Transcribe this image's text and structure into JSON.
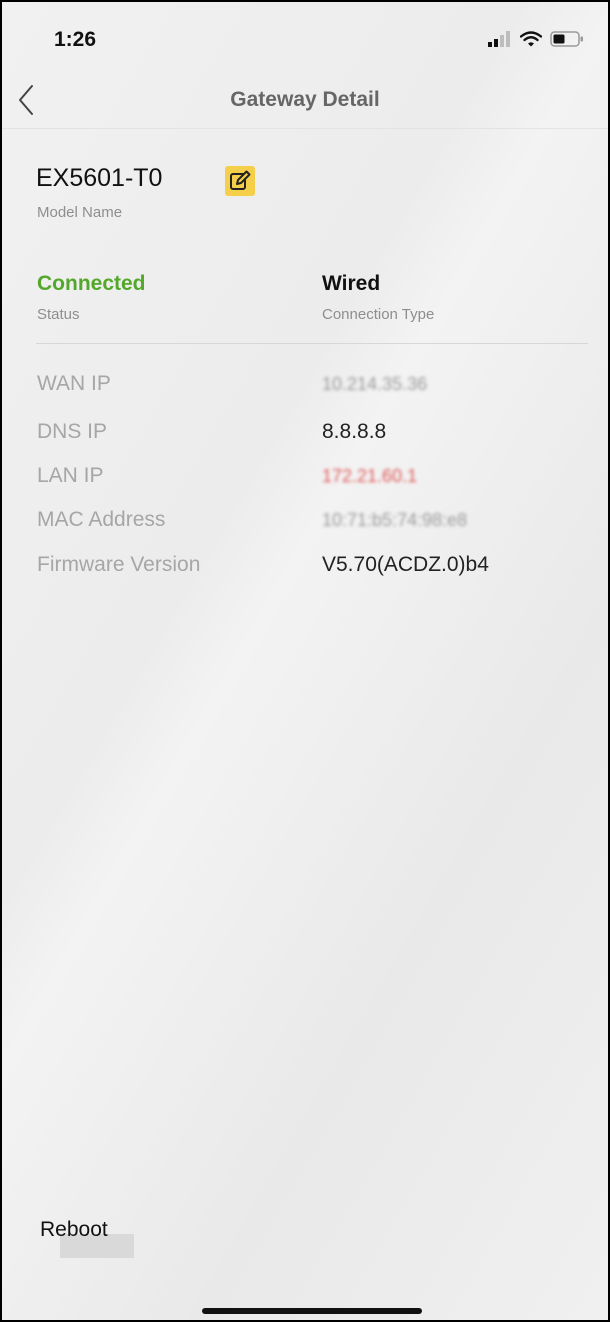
{
  "status_bar": {
    "time": "1:26",
    "icons": [
      "signal-icon",
      "wifi-icon",
      "battery-icon"
    ]
  },
  "nav": {
    "title": "Gateway Detail",
    "back_icon": "chevron-left-icon"
  },
  "device": {
    "model_name": "EX5601-T0",
    "model_caption": "Model Name",
    "edit_icon": "edit-icon",
    "edit_color": "#f6cf4a"
  },
  "summary": {
    "status_value": "Connected",
    "status_caption": "Status",
    "status_color": "#53a82b",
    "connection_value": "Wired",
    "connection_caption": "Connection Type"
  },
  "details": [
    {
      "label": "WAN IP",
      "value": "10.214.35.36",
      "blurred": true
    },
    {
      "label": "DNS IP",
      "value": "8.8.8.8",
      "blurred": false
    },
    {
      "label": "LAN IP",
      "value": "172.21.60.1",
      "blurred": true
    },
    {
      "label": "MAC Address",
      "value": "10:71:b5:74:98:e8",
      "blurred": true
    },
    {
      "label": "Firmware Version",
      "value": "V5.70(ACDZ.0)b4",
      "blurred": false
    }
  ],
  "actions": {
    "reboot_label": "Reboot"
  }
}
